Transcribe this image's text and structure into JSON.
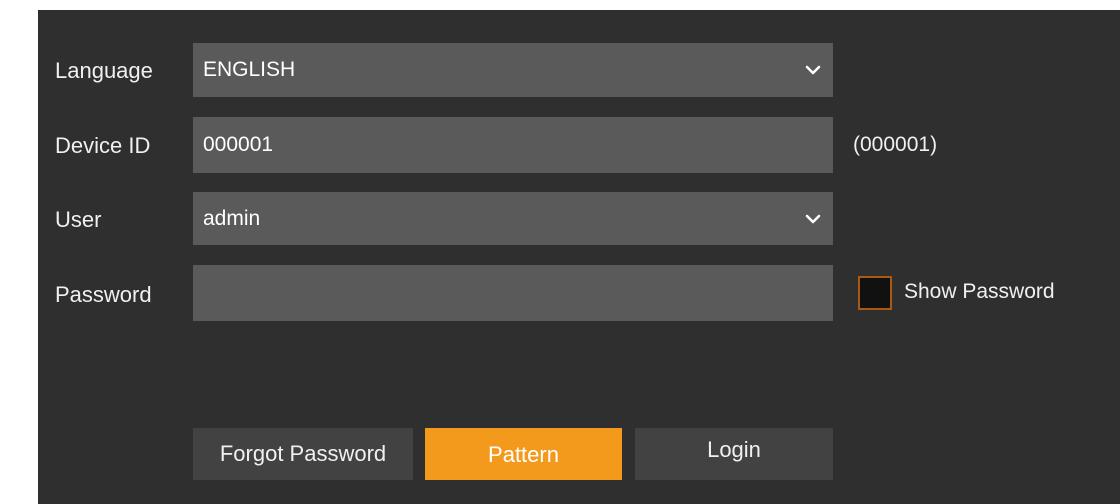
{
  "form": {
    "language_label": "Language",
    "language_value": "ENGLISH",
    "device_id_label": "Device ID",
    "device_id_value": "000001",
    "device_id_hint": "(000001)",
    "user_label": "User",
    "user_value": "admin",
    "password_label": "Password",
    "password_value": "",
    "show_password_label": "Show Password",
    "show_password_checked": false
  },
  "buttons": {
    "forgot_password": "Forgot Password",
    "pattern": "Pattern",
    "login": "Login"
  },
  "colors": {
    "panel_bg": "#2f2f2f",
    "field_bg": "#5a5a5a",
    "button_bg": "#424242",
    "accent": "#f39a1d",
    "checkbox_border": "#a85a10"
  },
  "icons": {
    "language_dropdown": "chevron-down-icon",
    "user_dropdown": "chevron-down-icon"
  }
}
